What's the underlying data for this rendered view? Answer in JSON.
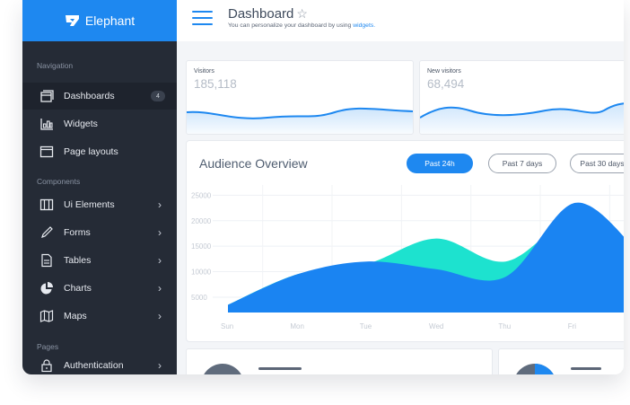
{
  "brand": {
    "name": "Elephant"
  },
  "sidebar": {
    "sections": [
      {
        "label": "Navigation"
      },
      {
        "label": "Components"
      },
      {
        "label": "Pages"
      }
    ],
    "items": [
      {
        "label": "Dashboards",
        "badge": "4",
        "icon": "dashboard-icon"
      },
      {
        "label": "Widgets",
        "icon": "widgets-icon"
      },
      {
        "label": "Page layouts",
        "icon": "layout-icon"
      },
      {
        "label": "Ui Elements",
        "icon": "ui-elements-icon"
      },
      {
        "label": "Forms",
        "icon": "pencil-icon"
      },
      {
        "label": "Tables",
        "icon": "document-icon"
      },
      {
        "label": "Charts",
        "icon": "pie-chart-icon"
      },
      {
        "label": "Maps",
        "icon": "map-icon"
      },
      {
        "label": "Authentication",
        "icon": "lock-icon"
      }
    ]
  },
  "header": {
    "title": "Dashboard",
    "star": "☆",
    "subtitle_prefix": "You can personalize your dashboard by using ",
    "subtitle_link": "widgets."
  },
  "stats": [
    {
      "label": "Visitors",
      "value": "185,118"
    },
    {
      "label": "New visitors",
      "value": "68,494"
    }
  ],
  "audience": {
    "title": "Audience Overview",
    "filters": [
      "Past 24h",
      "Past 7 days",
      "Past 30 days"
    ],
    "active_filter": "Past 24h"
  },
  "chart_data": {
    "type": "area",
    "title": "",
    "categories": [
      "Sun",
      "Mon",
      "Tue",
      "Wed",
      "Thu",
      "Fri"
    ],
    "y_ticks": [
      "25000",
      "20000",
      "15000",
      "10000",
      "5000"
    ],
    "ylim": [
      2000,
      27000
    ],
    "series": [
      {
        "color": "#1de2cf",
        "values": [
          3500,
          9500,
          11500,
          16500,
          12000,
          20500,
          14500
        ]
      },
      {
        "color": "#1a84f2",
        "values": [
          3500,
          9500,
          12000,
          10500,
          9000,
          23500,
          14000
        ]
      }
    ],
    "x_positions": [
      0,
      1,
      2,
      3,
      4,
      5,
      5.9
    ],
    "grid": true
  },
  "colors": {
    "accent": "#1e88f0",
    "sidebar": "#252b36",
    "teal": "#1de2cf"
  }
}
